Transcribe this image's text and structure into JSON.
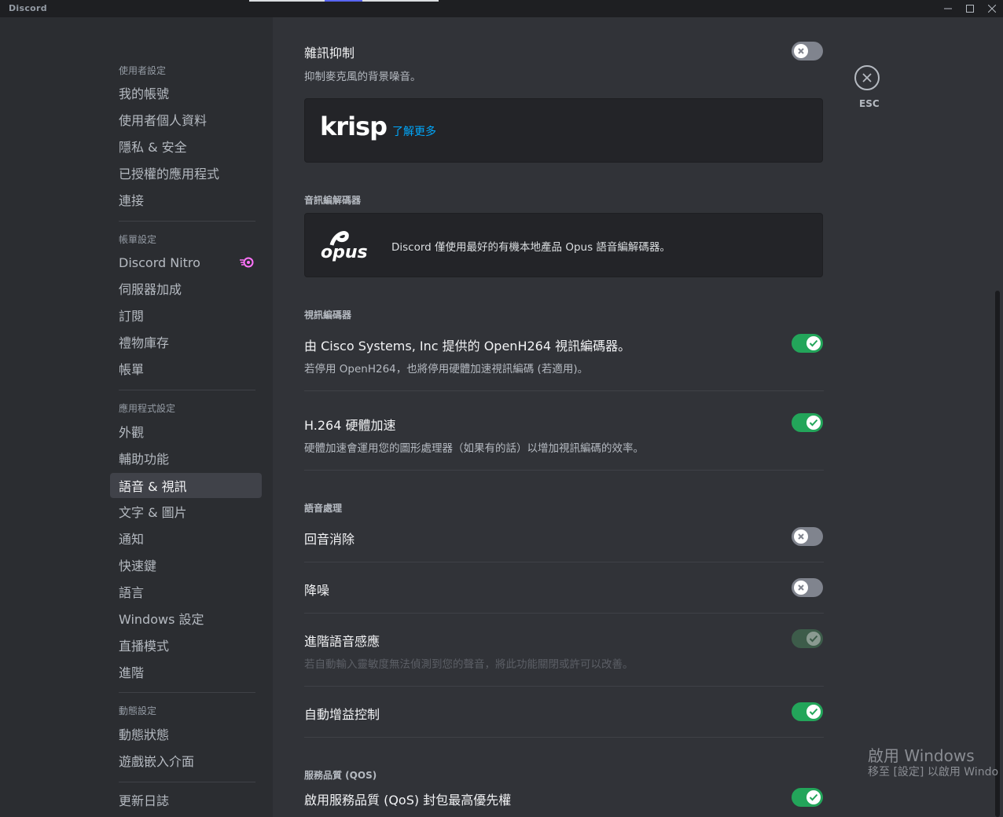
{
  "window": {
    "app_name": "Discord"
  },
  "sidebar": {
    "sections": [
      {
        "header": "使用者設定",
        "items": [
          "我的帳號",
          "使用者個人資料",
          "隱私 & 安全",
          "已授權的應用程式",
          "連接"
        ]
      },
      {
        "header": "帳單設定",
        "items": [
          "Discord Nitro",
          "伺服器加成",
          "訂閱",
          "禮物庫存",
          "帳單"
        ]
      },
      {
        "header": "應用程式設定",
        "items": [
          "外觀",
          "輔助功能",
          "語音 & 視訊",
          "文字 & 圖片",
          "通知",
          "快速鍵",
          "語言",
          "Windows 設定",
          "直播模式",
          "進階"
        ]
      },
      {
        "header": "動態設定",
        "items": [
          "動態狀態",
          "遊戲嵌入介面"
        ]
      },
      {
        "header": "",
        "items": [
          "更新日誌"
        ]
      }
    ],
    "active_item": "語音 & 視訊"
  },
  "close": {
    "label": "ESC"
  },
  "noise_suppression": {
    "title": "雜訊抑制",
    "desc": "抑制麥克風的背景噪音。",
    "enabled": false,
    "krisp_logo": "krisp",
    "learn_more": "了解更多"
  },
  "audio_codec": {
    "header": "音訊編解碼器",
    "logo": "opus",
    "text": "Discord 僅使用最好的有機本地產品 Opus 語音編解碼器。"
  },
  "video_codec": {
    "header": "視訊編碼器",
    "openh264_title": "由 Cisco Systems, Inc 提供的 OpenH264 視訊編碼器。",
    "openh264_desc": "若停用 OpenH264，也將停用硬體加速視訊編碼 (若適用)。",
    "openh264_enabled": true,
    "h264_title": "H.264 硬體加速",
    "h264_desc": "硬體加速會運用您的圖形處理器（如果有的話）以增加視訊編碼的效率。",
    "h264_enabled": true
  },
  "voice_processing": {
    "header": "語音處理",
    "echo_title": "回音消除",
    "echo_enabled": false,
    "noise_title": "降噪",
    "noise_enabled": false,
    "advanced_title": "進階語音感應",
    "advanced_desc": "若自動輸入靈敏度無法偵測到您的聲音，將此功能關閉或許可以改善。",
    "advanced_enabled": true,
    "agc_title": "自動增益控制",
    "agc_enabled": true
  },
  "qos": {
    "header": "服務品質 (QOS)",
    "title": "啟用服務品質 (QoS) 封包最高優先權",
    "enabled": true
  },
  "watermark": {
    "title": "啟用 Windows",
    "subtitle": "移至 [設定] 以啟用 Windo"
  },
  "colors": {
    "accent": "#5865f2",
    "toggle_on": "#23a55a",
    "toggle_off": "#80848e",
    "link": "#00a8fc",
    "nitro": "#ff73fa"
  }
}
